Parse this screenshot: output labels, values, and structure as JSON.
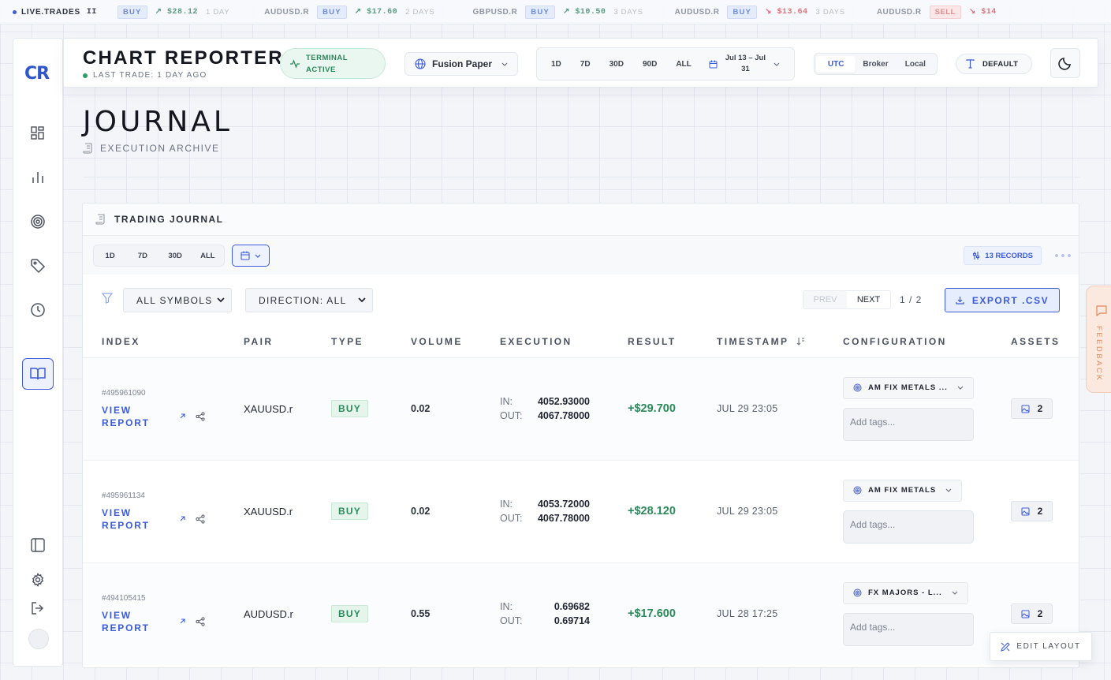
{
  "ticker": {
    "label": "LIVE.TRADES",
    "pause": "II",
    "items": [
      {
        "symbol": "",
        "side": "BUY",
        "pnl": "$28.12",
        "age": "1 DAY",
        "dir": "up"
      },
      {
        "symbol": "AUDUSD.R",
        "side": "BUY",
        "pnl": "$17.60",
        "age": "2 DAYS",
        "dir": "up"
      },
      {
        "symbol": "GBPUSD.R",
        "side": "BUY",
        "pnl": "$10.50",
        "age": "3 DAYS",
        "dir": "up"
      },
      {
        "symbol": "AUDUSD.R",
        "side": "BUY",
        "pnl": "$13.64",
        "age": "3 DAYS",
        "dir": "down"
      },
      {
        "symbol": "AUDUSD.R",
        "side": "SELL",
        "pnl": "$14",
        "age": "",
        "dir": "down"
      }
    ]
  },
  "sidebar": {
    "logo": "CR"
  },
  "header": {
    "title": "CHART REPORTER",
    "last_trade": "LAST TRADE: 1 DAY AGO",
    "terminal_line1": "TERMINAL",
    "terminal_line2": "ACTIVE",
    "account": "Fusion Paper",
    "ranges": [
      "1D",
      "7D",
      "30D",
      "90D",
      "ALL"
    ],
    "date_line1": "Jul 13 – Jul",
    "date_line2": "31",
    "timezones": [
      "UTC",
      "Broker",
      "Local"
    ],
    "theme": "DEFAULT"
  },
  "page": {
    "title": "JOURNAL",
    "subtitle": "EXECUTION ARCHIVE"
  },
  "journal": {
    "card_title": "TRADING JOURNAL",
    "quick_ranges": [
      "1D",
      "7D",
      "30D",
      "ALL"
    ],
    "records": "13 RECORDS",
    "symbol_filter": "ALL SYMBOLS",
    "direction_filter": "DIRECTION: ALL",
    "prev": "PREV",
    "next": "NEXT",
    "page": "1 / 2",
    "export": "EXPORT .CSV",
    "columns": [
      "INDEX",
      "PAIR",
      "TYPE",
      "VOLUME",
      "EXECUTION",
      "RESULT",
      "TIMESTAMP",
      "CONFIGURATION",
      "ASSETS"
    ],
    "view_report": "VIEW REPORT",
    "in_label": "IN:",
    "out_label": "OUT:",
    "tags_placeholder": "Add tags...",
    "rows": [
      {
        "index": "#495961090",
        "pair": "XAUUSD.r",
        "type": "BUY",
        "volume": "0.02",
        "in": "4052.93000",
        "out": "4067.78000",
        "result": "+$29.700",
        "timestamp": "JUL 29 23:05",
        "config": "AM FIX METALS ...",
        "assets": "2"
      },
      {
        "index": "#495961134",
        "pair": "XAUUSD.r",
        "type": "BUY",
        "volume": "0.02",
        "in": "4053.72000",
        "out": "4067.78000",
        "result": "+$28.120",
        "timestamp": "JUL 29 23:05",
        "config": "AM FIX METALS",
        "assets": "2"
      },
      {
        "index": "#494105415",
        "pair": "AUDUSD.r",
        "type": "BUY",
        "volume": "0.55",
        "in": "0.69682",
        "out": "0.69714",
        "result": "+$17.600",
        "timestamp": "JUL 28 17:25",
        "config": "FX MAJORS - L...",
        "assets": "2"
      }
    ]
  },
  "feedback": "FEEDBACK",
  "edit_layout": "EDIT LAYOUT"
}
